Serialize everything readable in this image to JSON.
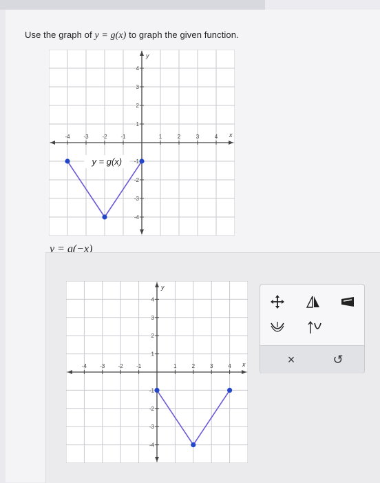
{
  "prompt": {
    "before": "Use the graph of ",
    "math": "y = g(x)",
    "after": " to graph the given function."
  },
  "given_graph": {
    "curve_label": "y = g(x)",
    "axis_x": "x",
    "axis_y": "y",
    "x_ticks": [
      "-4",
      "-3",
      "-2",
      "-1",
      "1",
      "2",
      "3",
      "4"
    ],
    "y_ticks": [
      "4",
      "3",
      "2",
      "1",
      "-1",
      "-2",
      "-3",
      "-4"
    ]
  },
  "target_function": "y = g(−x)",
  "answer_graph": {
    "axis_x": "x",
    "axis_y": "y",
    "x_ticks": [
      "-4",
      "-3",
      "-2",
      "-1",
      "1",
      "2",
      "3",
      "4"
    ],
    "y_ticks": [
      "4",
      "3",
      "2",
      "1",
      "-1",
      "-2",
      "-3",
      "-4"
    ]
  },
  "chart_data": [
    {
      "type": "line",
      "title": "",
      "series": [
        {
          "name": "y = g(x)",
          "x": [
            -4,
            -2,
            0
          ],
          "y": [
            -1,
            -4,
            -1
          ]
        }
      ],
      "xlim": [
        -5,
        5
      ],
      "ylim": [
        -5,
        5
      ],
      "grid": true,
      "points_marked": true
    },
    {
      "type": "line",
      "title": "",
      "series": [
        {
          "x": [
            0,
            2,
            4
          ],
          "y": [
            -1,
            -4,
            -1
          ]
        }
      ],
      "xlim": [
        -5,
        5
      ],
      "ylim": [
        -5,
        5
      ],
      "grid": true,
      "points_marked": true
    }
  ],
  "toolbox": {
    "tools": [
      "move-icon",
      "reflect-icon",
      "scale-icon",
      "stretch-icon",
      "shift-icon"
    ],
    "delete_label": "×",
    "undo_label": "↺"
  },
  "colors": {
    "curve": "#6b5bd6",
    "point": "#2447c9",
    "grid": "#c9c9cf",
    "axis": "#444444"
  }
}
